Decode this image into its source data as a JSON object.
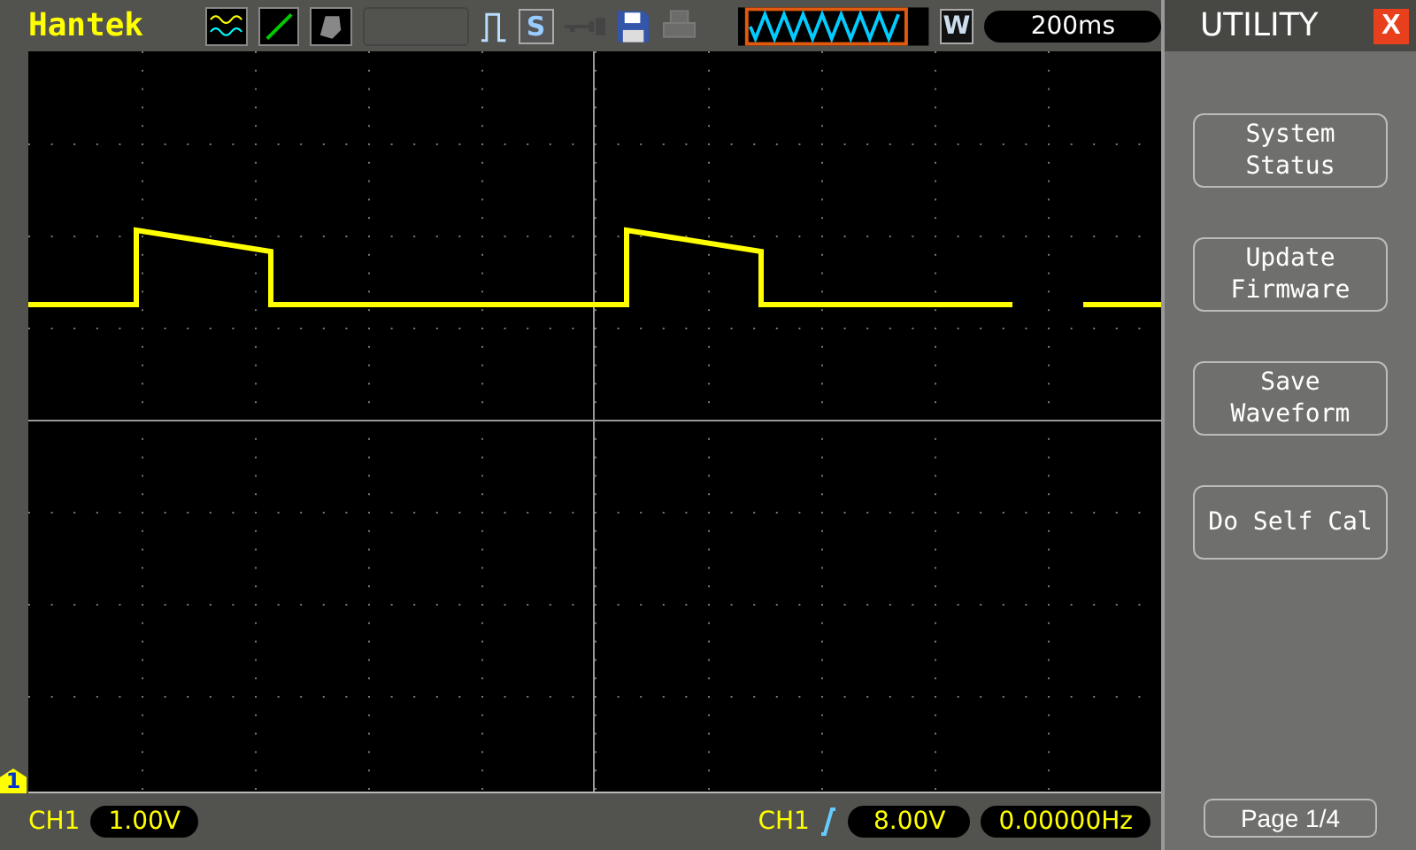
{
  "top_bar": {
    "brand": "Hantek",
    "s_key": "S",
    "timebase_mode": "W",
    "timebase": "200ms"
  },
  "menu": {
    "title": "UTILITY",
    "close": "X",
    "buttons": [
      {
        "label": "System Status"
      },
      {
        "label": "Update Firmware"
      },
      {
        "label": "Save Waveform"
      },
      {
        "label": "Do Self Cal"
      }
    ],
    "page": "Page 1/4"
  },
  "screen": {
    "channel_marker": "1"
  },
  "bottom_bar": {
    "channel": "CH1",
    "volts_div": "1.00V",
    "trigger_channel": "CH1",
    "trigger_level": "8.00V",
    "frequency": "0.00000Hz"
  }
}
